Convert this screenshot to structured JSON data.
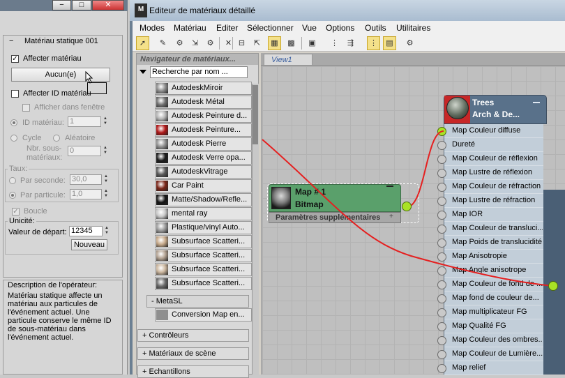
{
  "left_panel": {
    "rollout_title": "Matériau statique 001",
    "assign_material_label": "Affecter matériau",
    "assign_material_checked": true,
    "none_button_label": "Aucun(e)",
    "assign_id_label": "Affecter ID matériau",
    "show_in_viewport_label": "Afficher dans fenêtre",
    "material_id_label": "ID matériau:",
    "material_id_value": "1",
    "cycle_label": "Cycle",
    "random_label": "Aléatoire",
    "sub_material_count_label": "Nbr. sous-\nmatériaux:",
    "sub_material_count_value": "0",
    "rate_group_label": "Taux:",
    "per_second_label": "Par seconde:",
    "per_second_value": "30,0",
    "per_particle_label": "Par particule:",
    "per_particle_value": "1,0",
    "loop_label": "Boucle",
    "uniqueness_group_label": "Unicité:",
    "seed_label": "Valeur de départ:",
    "seed_value": "12345",
    "new_button_label": "Nouveau",
    "description_title": "Description de l'opérateur:",
    "description_text": "Matériau statique affecte un matériau aux particules de l'événement actuel. Une particule conserve le même ID de sous-matériau dans l'événement actuel."
  },
  "window": {
    "title": "Editeur de matériaux détaillé",
    "app_icon_text": "M"
  },
  "menu": [
    "Modes",
    "Matériau",
    "Editer",
    "Sélectionner",
    "Vue",
    "Options",
    "Outils",
    "Utilitaires"
  ],
  "navigator": {
    "title": "Navigateur de matériaux...",
    "search_placeholder": "Recherche par nom ...",
    "items": [
      {
        "label": "AutodeskMiroir",
        "swatch": "#8c8c8c"
      },
      {
        "label": "Autodesk Métal",
        "swatch": "#6f6f6f"
      },
      {
        "label": "Autodesk Peinture d...",
        "swatch": "#b5b5b5"
      },
      {
        "label": "Autodesk Peinture...",
        "swatch": "#b01818"
      },
      {
        "label": "Autodesk Pierre",
        "swatch": "#8f8f8f"
      },
      {
        "label": "Autodesk Verre opa...",
        "swatch": "#1b1b1b"
      },
      {
        "label": "AutodeskVitrage",
        "swatch": "#5a5a5a"
      },
      {
        "label": "Car Paint",
        "swatch": "#7a2518"
      },
      {
        "label": "Matte/Shadow/Refle...",
        "swatch": "#141414"
      },
      {
        "label": "mental ray",
        "swatch": "#c8c8c8"
      },
      {
        "label": "Plastique/vinyl Auto...",
        "swatch": "#9c9c9c"
      },
      {
        "label": "Subsurface Scatteri...",
        "swatch": "#c6a98a"
      },
      {
        "label": "Subsurface Scatteri...",
        "swatch": "#b3a292"
      },
      {
        "label": "Subsurface Scatteri...",
        "swatch": "#cbb69e"
      },
      {
        "label": "Subsurface Scatteri...",
        "swatch": "#6a6a6a"
      }
    ],
    "metasl_label": "- MetaSL",
    "conversion_map_label": "Conversion Map en...",
    "categories": [
      "+ Contrôleurs",
      "+ Matériaux de scène",
      "+ Echantillons"
    ]
  },
  "view": {
    "tab_label": "View1"
  },
  "map_node": {
    "title": "Map # 1",
    "subtitle": "Bitmap",
    "params_label": "Paramètres supplémentaires",
    "color": "#5aa06b"
  },
  "material_node": {
    "title": "Trees",
    "subtitle": "Arch & De...",
    "slots": [
      "Map Couleur diffuse",
      "Dureté",
      "Map Couleur de réflexion",
      "Map Lustre de réflexion",
      "Map Couleur de réfraction",
      "Map Lustre de réfraction",
      "Map IOR",
      "Map Couleur de transluci...",
      "Map Poids de translucidité",
      "Map Anisotropie",
      "Map Angle anisotrope",
      "Map Couleur de fond de ...",
      "Map fond de couleur de...",
      "Map multiplicateur FG",
      "Map Qualité FG",
      "Map Couleur des ombres...",
      "Map Couleur de Lumière...",
      "Map relief"
    ]
  },
  "colors": {
    "wire": "#e52020",
    "port_active": "#a9e226",
    "title_bar": "#a9bcd0"
  }
}
